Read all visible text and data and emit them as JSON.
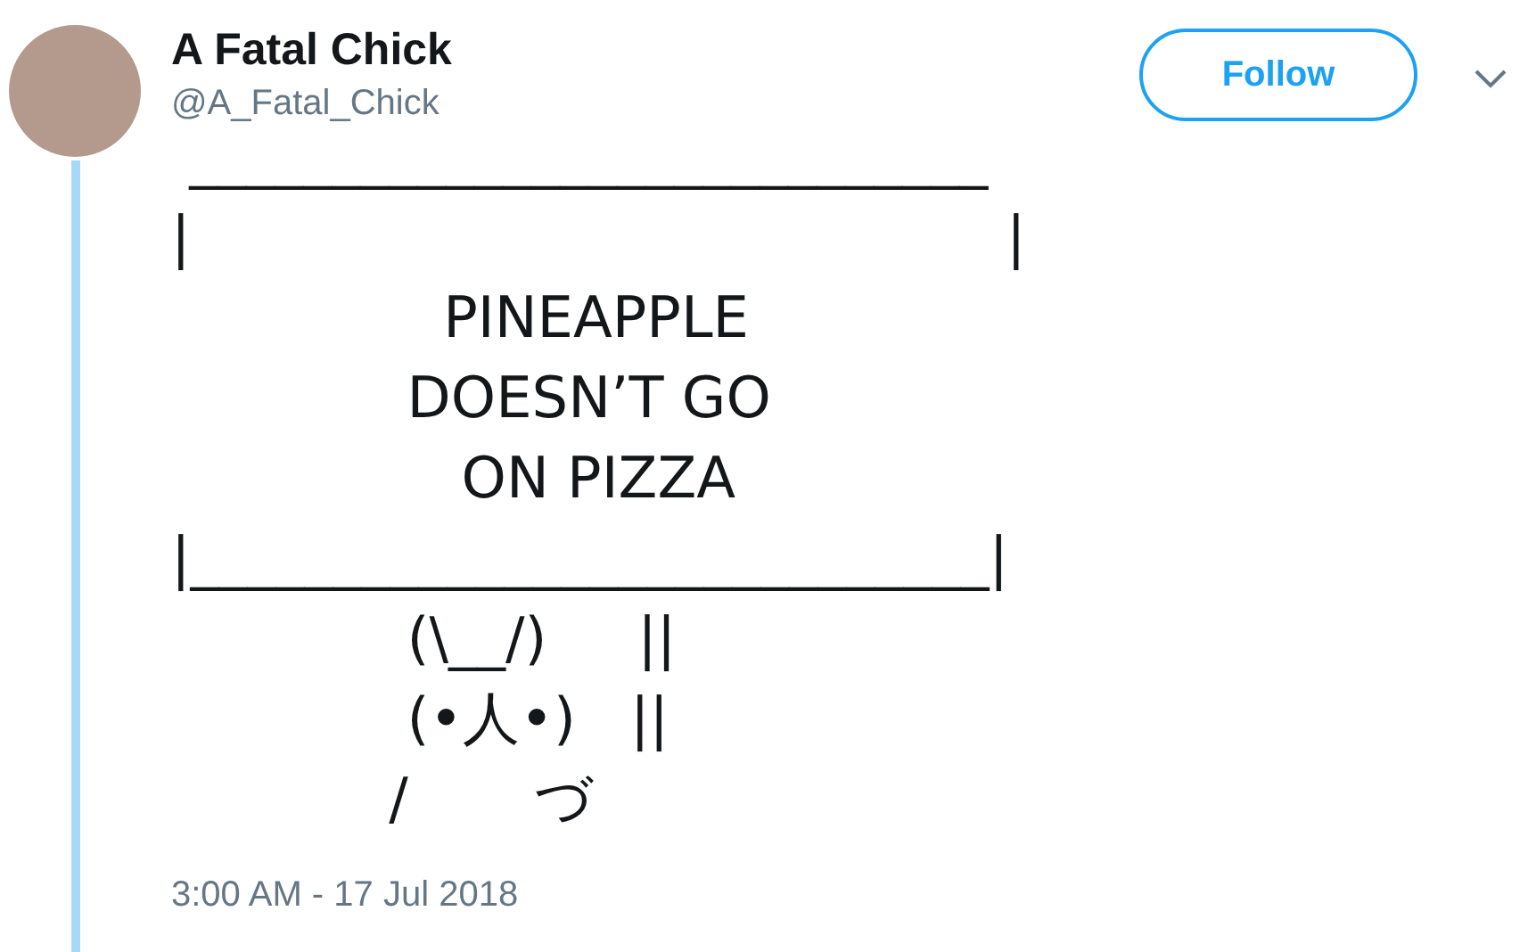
{
  "author": {
    "name": "A Fatal Chick",
    "handle": "@A_Fatal_Chick"
  },
  "follow_button": {
    "label": "Follow"
  },
  "tweet": {
    "lines": [
      " ____________________________",
      "|                                             |",
      "               PINEAPPLE",
      "             DOESN’T GO",
      "                ON PIZZA",
      "|____________________________|",
      "             (\\__/)     ||",
      "             (•人•)   ||",
      "            /       づ"
    ]
  },
  "timestamp": "3:00 AM - 17 Jul 2018"
}
